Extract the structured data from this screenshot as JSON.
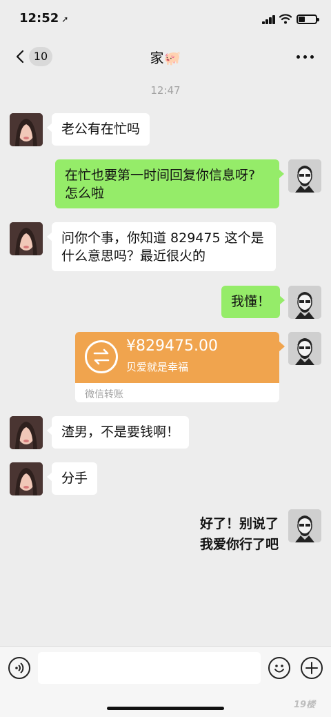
{
  "status_bar": {
    "time": "12:52",
    "location_glyph": "➚"
  },
  "nav": {
    "unread_count": "10",
    "title": "家🐖",
    "more_glyph": "•••"
  },
  "chat": {
    "timestamp": "12:47",
    "messages": [
      {
        "side": "in",
        "text": "老公有在忙吗"
      },
      {
        "side": "out",
        "line1": "在忙也要第一时间回复你信息呀?",
        "line2": "怎么啦"
      },
      {
        "side": "in",
        "line1": "问你个事，你知道 829475 这个是",
        "line2": "什么意思吗？最近很火的"
      },
      {
        "side": "out",
        "text": "我懂！"
      },
      {
        "side": "out",
        "type": "transfer",
        "amount": "¥829475.00",
        "note": "贝爱就是幸福",
        "label": "微信转账"
      },
      {
        "side": "in",
        "text": "渣男，不是要钱啊！"
      },
      {
        "side": "in",
        "text": "分手"
      },
      {
        "side": "out",
        "line1": "好了！别说了",
        "line2": "我爱你行了吧"
      }
    ]
  },
  "input_bar": {
    "placeholder": ""
  },
  "watermark": "19楼",
  "colors": {
    "background": "#ededed",
    "outgoing_bubble": "#95ec69",
    "incoming_bubble": "#ffffff",
    "transfer": "#f0a44e"
  },
  "icons": [
    "location-arrow-icon",
    "signal-icon",
    "wifi-icon",
    "battery-icon",
    "back-chevron-icon",
    "more-dots-icon",
    "transfer-arrows-icon",
    "voice-icon",
    "emoji-icon",
    "plus-icon"
  ]
}
